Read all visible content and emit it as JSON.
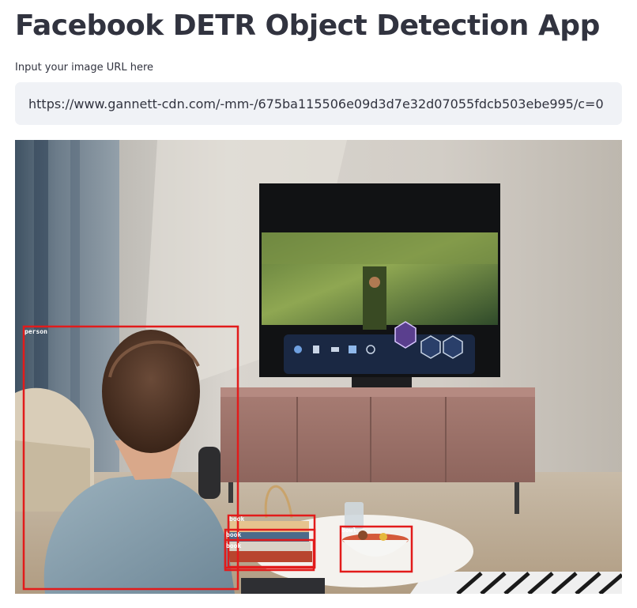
{
  "app": {
    "title": "Facebook DETR Object Detection App"
  },
  "url_input": {
    "label": "Input your image URL here",
    "value": "https://www.gannett-cdn.com/-mm-/675ba115506e09d3d7e32d07055fdcb503ebe995/c=0"
  },
  "detections": {
    "box_color": "#e21b1b",
    "items": [
      {
        "label": "person"
      },
      {
        "label": "book"
      },
      {
        "label": "book"
      },
      {
        "label": "book"
      },
      {
        "label": "bowl"
      }
    ]
  },
  "colors": {
    "text": "#31333f",
    "input_background": "#f0f2f6"
  },
  "icons": {
    "tv_menu": [
      "home-icon",
      "file-icon",
      "hdmi-icon",
      "game-icon",
      "headset-icon",
      "cube-icon",
      "equals-icon",
      "gear-icon"
    ]
  }
}
